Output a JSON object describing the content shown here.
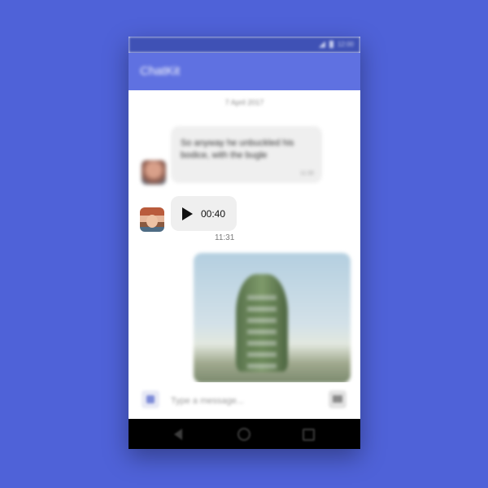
{
  "app": {
    "title": "ChatKit"
  },
  "status_bar": {
    "time": "12:00"
  },
  "chat": {
    "date_separator": "7 April 2017",
    "messages": [
      {
        "type": "text",
        "text": "So anyway he unbuckled his bodice, with the bugle",
        "time": "11:30"
      },
      {
        "type": "voice",
        "duration": "00:40",
        "time": "11:31"
      },
      {
        "type": "image",
        "description": "vertical garden tower"
      }
    ]
  },
  "input": {
    "placeholder": "Type a message..."
  },
  "icons": {
    "emoji": "emoji-icon",
    "send": "send-icon",
    "play": "play-icon",
    "back": "back-icon",
    "home": "home-icon",
    "recent": "recent-apps-icon"
  },
  "colors": {
    "background": "#4f62d8",
    "status_bar": "#3f51b5",
    "app_bar": "#5f71e1",
    "bubble": "#efefef"
  }
}
